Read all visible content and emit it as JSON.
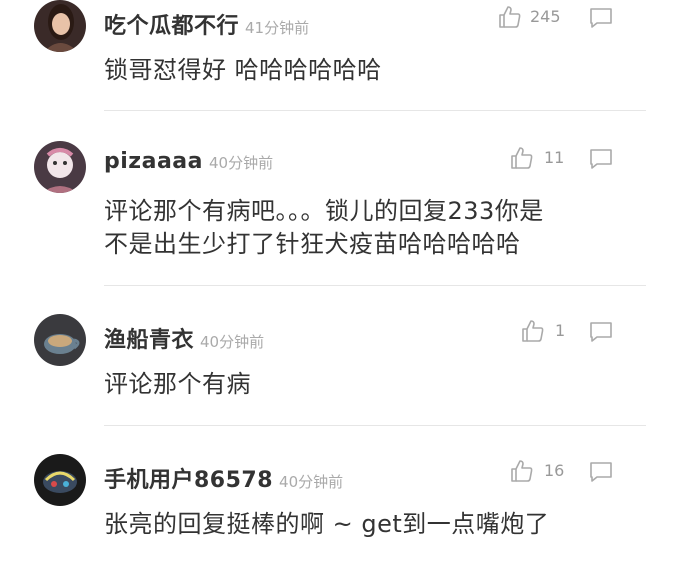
{
  "comments": [
    {
      "username": "吃个瓜都不行",
      "time": "41分钟前",
      "likes": "245",
      "content_lines": [
        "锁哥怼得好 哈哈哈哈哈哈"
      ],
      "avatar_colors": {
        "bg": "#3a2a28",
        "face": "#e8c2a8",
        "hair": "#2a1a14"
      }
    },
    {
      "username": "pizaaaa",
      "time": "40分钟前",
      "likes": "11",
      "content_lines": [
        "评论那个有病吧。。。锁儿的回复233你是",
        "不是出生少打了针狂犬疫苗哈哈哈哈哈"
      ],
      "avatar_colors": {
        "bg": "#4a3a44",
        "face": "#f2e6ea",
        "hair": "#d88aa8"
      }
    },
    {
      "username": "渔船青衣",
      "time": "40分钟前",
      "likes": "1",
      "content_lines": [
        "评论那个有病"
      ],
      "avatar_colors": {
        "bg": "#3a3a3e",
        "face": "#c9a87c",
        "hair": "#6a8090"
      }
    },
    {
      "username": "手机用户86578",
      "time": "40分钟前",
      "likes": "16",
      "content_lines": [
        "张亮的回复挺棒的啊 ~ get到一点嘴炮了"
      ],
      "avatar_colors": {
        "bg": "#1a1a1a",
        "face": "#3a4a60",
        "hair": "#e8d86a"
      }
    }
  ],
  "colors": {
    "username": "#333333",
    "time": "#aaaaaa",
    "icon": "#aaaaaa",
    "divider": "#e6e6e6"
  },
  "icons": {
    "like": "thumbs-up-icon",
    "reply": "speech-bubble-icon"
  }
}
